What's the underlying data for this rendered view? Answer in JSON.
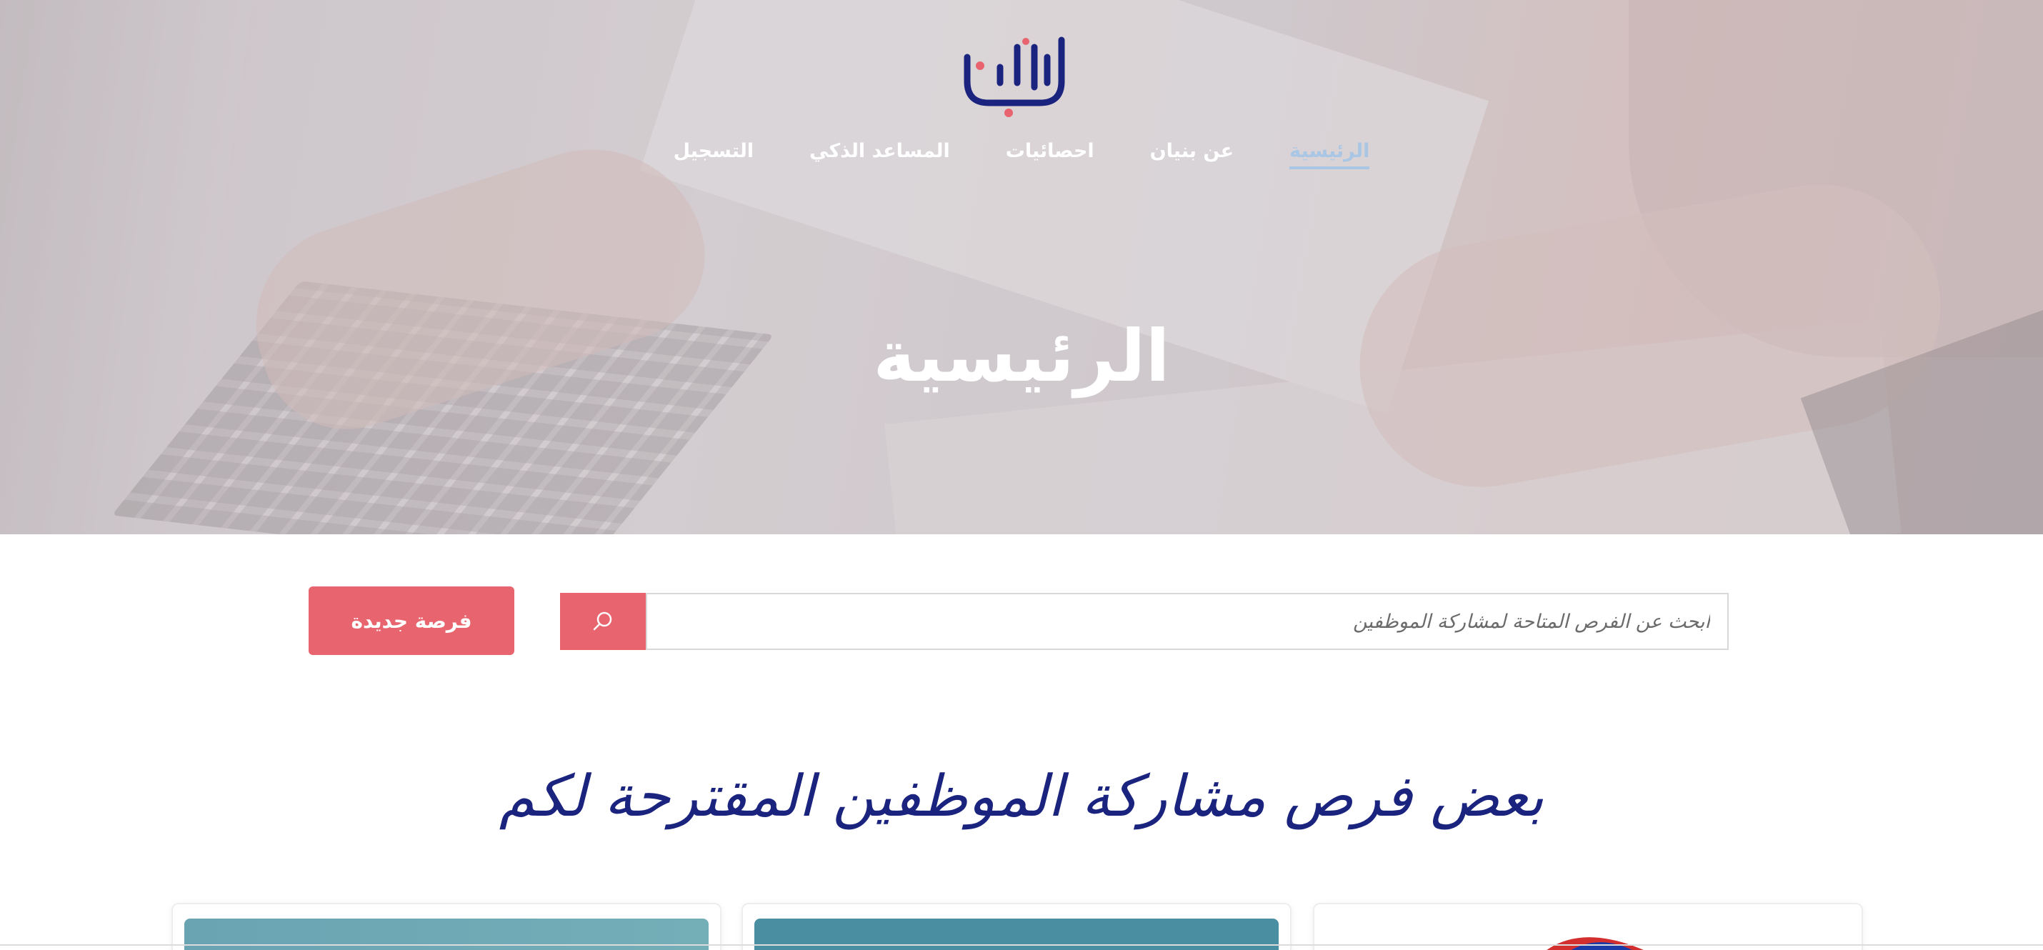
{
  "nav": {
    "items": [
      {
        "label": "الرئيسية",
        "active": true
      },
      {
        "label": "عن بنيان",
        "active": false
      },
      {
        "label": "احصائيات",
        "active": false
      },
      {
        "label": "المساعد الذكي",
        "active": false
      },
      {
        "label": "التسجيل",
        "active": false
      }
    ]
  },
  "hero": {
    "title": "الرئيسية"
  },
  "search": {
    "placeholder": "ابحث عن الفرص المتاحة لمشاركة الموظفين",
    "button_icon": "search-icon"
  },
  "actions": {
    "new_opportunity": "فرصة جديدة"
  },
  "section": {
    "title": "بعض فرص مشاركة الموظفين المقترحة لكم"
  },
  "colors": {
    "brand_navy": "#1a237e",
    "accent_red": "#e8646e",
    "nav_active": "#a9c6e4"
  }
}
